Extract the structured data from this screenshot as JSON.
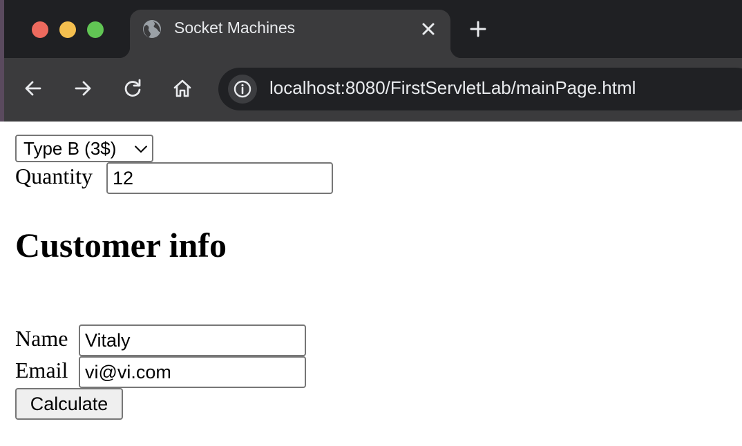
{
  "browser": {
    "tab_title": "Socket Machines",
    "url": "localhost:8080/FirstServletLab/mainPage.html"
  },
  "form": {
    "machine_type": {
      "selected": "Type B (3$)"
    },
    "quantity": {
      "label": "Quantity",
      "value": "12"
    },
    "customer_heading": "Customer info",
    "name": {
      "label": "Name",
      "value": "Vitaly"
    },
    "email": {
      "label": "Email",
      "value": "vi@vi.com"
    },
    "submit_label": "Calculate"
  },
  "colors": {
    "tabbar_bg": "#1f2023",
    "toolbar_bg": "#3b3b3d",
    "close_dot": "#ed6a5e",
    "minimize_dot": "#f4bf4f",
    "maximize_dot": "#61c554"
  },
  "icons": {
    "favicon": "globe-icon",
    "tab_close": "close-icon",
    "new_tab": "plus-icon",
    "back": "arrow-left-icon",
    "forward": "arrow-right-icon",
    "reload": "reload-icon",
    "home": "home-icon",
    "site_info": "info-icon",
    "select": "chevron-down-icon"
  }
}
